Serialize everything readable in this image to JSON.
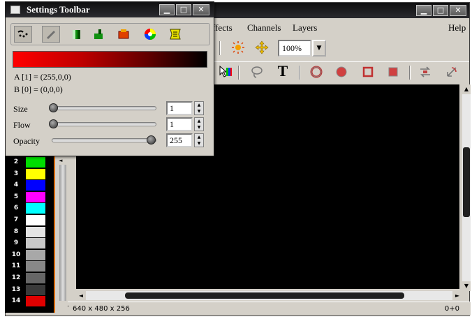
{
  "settings_window": {
    "title": "Settings Toolbar",
    "tools": [
      "brush-icon",
      "pencil-icon",
      "gradient-fill-icon",
      "paint-bucket-icon",
      "stamp-icon",
      "color-wheel-icon",
      "effects-icon"
    ],
    "color_a": "A [1] = (255,0,0)",
    "color_b": "B [0] = (0,0,0)",
    "size_label": "Size",
    "size_value": "1",
    "flow_label": "Flow",
    "flow_value": "1",
    "opacity_label": "Opacity",
    "opacity_value": "255",
    "gradient_from": "#ff0000",
    "gradient_to": "#000000"
  },
  "main_window": {
    "menu": [
      "Effects",
      "Channels",
      "Layers",
      "Help"
    ],
    "menu_effects_visible": "ffects",
    "zoom": "100%",
    "status_left": "640 x 480 x 256",
    "status_right": "0+0"
  },
  "palette": [
    {
      "index": "2",
      "color": "#00dd00"
    },
    {
      "index": "3",
      "color": "#ffff00"
    },
    {
      "index": "4",
      "color": "#0000ff"
    },
    {
      "index": "5",
      "color": "#ff00ff"
    },
    {
      "index": "6",
      "color": "#00ffff"
    },
    {
      "index": "7",
      "color": "#ffffff"
    },
    {
      "index": "8",
      "color": "#e4e4e4"
    },
    {
      "index": "9",
      "color": "#c8c8c8"
    },
    {
      "index": "10",
      "color": "#a8a8a8"
    },
    {
      "index": "11",
      "color": "#888888"
    },
    {
      "index": "12",
      "color": "#666666"
    },
    {
      "index": "13",
      "color": "#3a3a3a"
    },
    {
      "index": "14",
      "color": "#e00000"
    }
  ]
}
